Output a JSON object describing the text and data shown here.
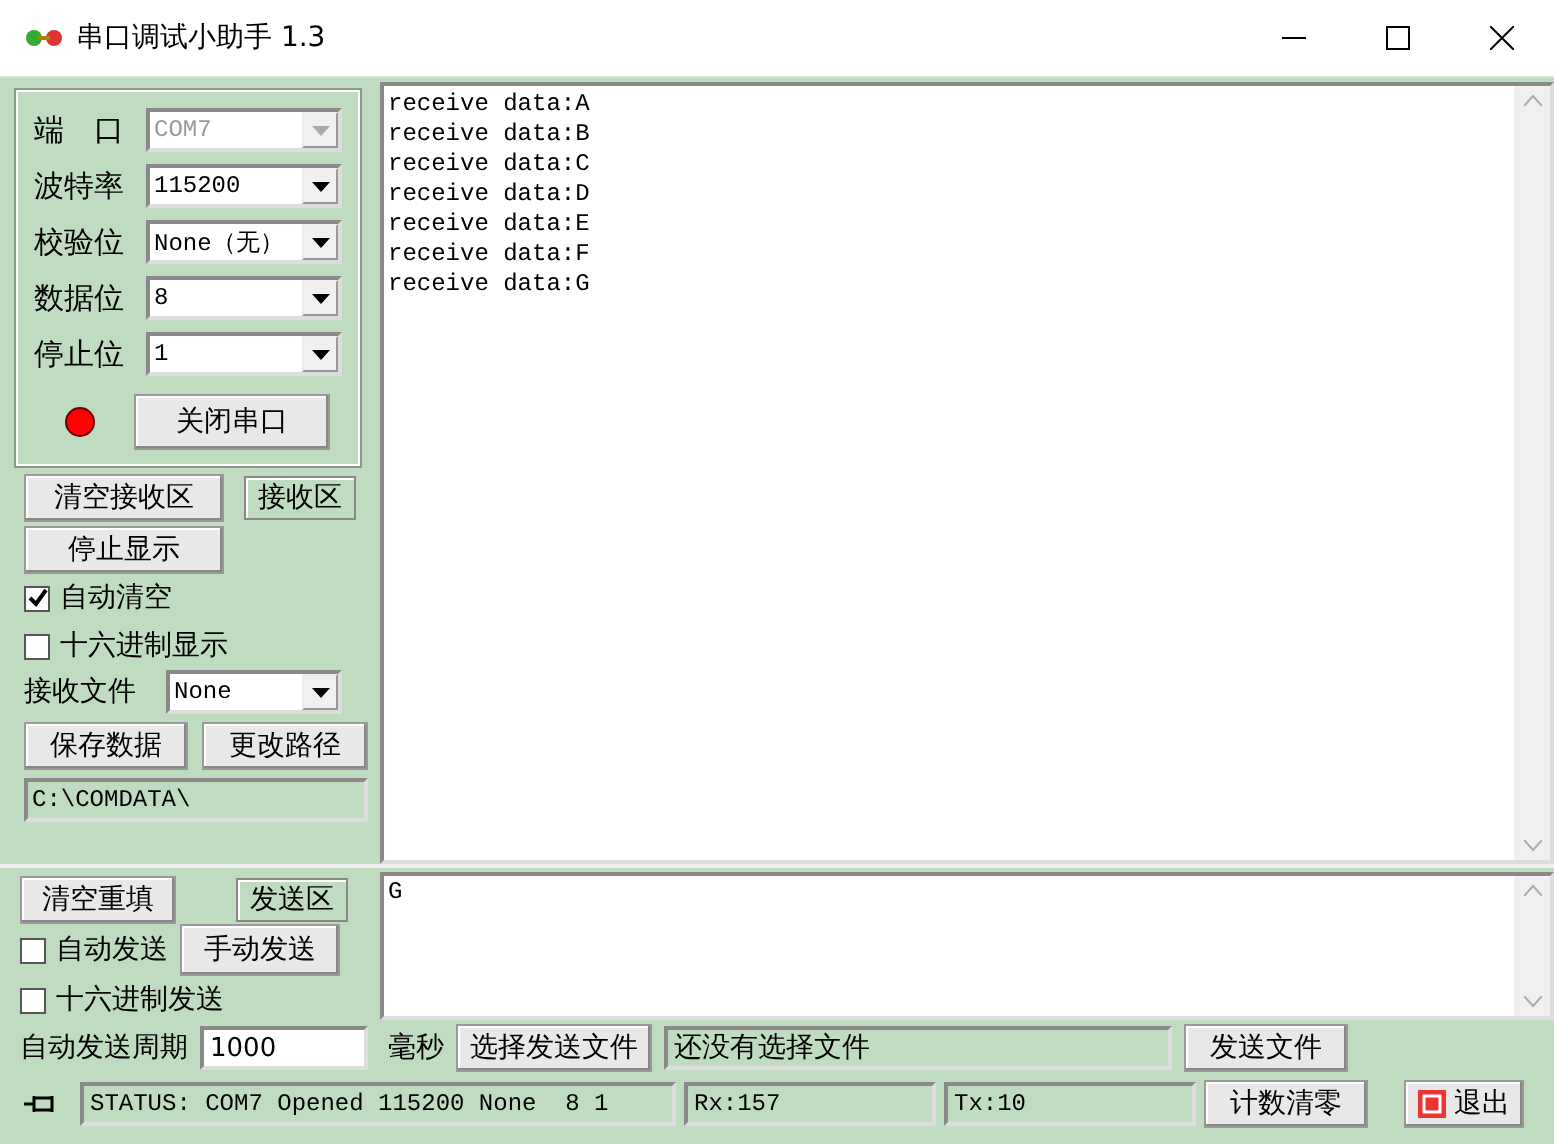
{
  "window": {
    "title": "串口调试小助手 1.3"
  },
  "serial_settings": [
    {
      "label": "端　口",
      "value": "COM7",
      "disabled": true
    },
    {
      "label": "波特率",
      "value": "115200",
      "disabled": false
    },
    {
      "label": "校验位",
      "value": "None（无）",
      "disabled": false
    },
    {
      "label": "数据位",
      "value": "8",
      "disabled": false
    },
    {
      "label": "停止位",
      "value": "1",
      "disabled": false
    }
  ],
  "led": {
    "on": true
  },
  "open_button": "关闭串口",
  "receive": {
    "clear_button": "清空接收区",
    "area_label": "接收区",
    "stop_button": "停止显示",
    "auto_clear": {
      "label": "自动清空",
      "checked": true
    },
    "hex_display": {
      "label": "十六进制显示",
      "checked": false
    },
    "file_label": "接收文件",
    "file_value": "None",
    "save_button": "保存数据",
    "change_path_button": "更改路径",
    "path": "C:\\COMDATA\\",
    "lines": [
      "receive data:A",
      "receive data:B",
      "receive data:C",
      "receive data:D",
      "receive data:E",
      "receive data:F",
      "receive data:G"
    ]
  },
  "send": {
    "clear_button": "清空重填",
    "area_label": "发送区",
    "auto_send": {
      "label": "自动发送",
      "checked": false
    },
    "manual_button": "手动发送",
    "hex_send": {
      "label": "十六进制发送",
      "checked": false
    },
    "text": "G",
    "period_label": "自动发送周期",
    "period_value": "1000",
    "unit": "毫秒",
    "choose_file_button": "选择发送文件",
    "file_status": "还没有选择文件",
    "send_file_button": "发送文件"
  },
  "status_bar": {
    "status": "STATUS: COM7 Opened 115200 None  8 1",
    "rx": "Rx:157",
    "tx": "Tx:10",
    "reset_button": "计数清零",
    "exit_button": "退出"
  }
}
